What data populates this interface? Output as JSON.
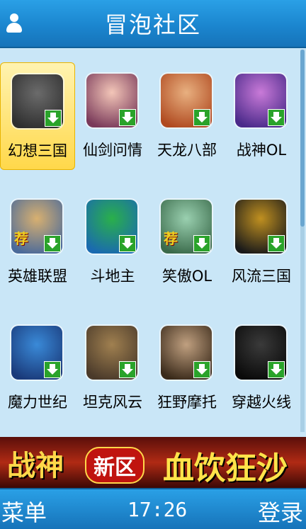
{
  "header": {
    "title": "冒泡社区",
    "user_icon": "user-icon"
  },
  "games": [
    {
      "label": "幻想三国",
      "selected": true,
      "recommended": false,
      "c1": "#6b6b6b",
      "c2": "#2f2f2f"
    },
    {
      "label": "仙剑问情",
      "selected": false,
      "recommended": false,
      "c1": "#f3c6b8",
      "c2": "#7a3a5a"
    },
    {
      "label": "天龙八部",
      "selected": false,
      "recommended": false,
      "c1": "#e8b080",
      "c2": "#b04a20"
    },
    {
      "label": "战神OL",
      "selected": false,
      "recommended": false,
      "c1": "#c97ad8",
      "c2": "#4a2a8a"
    },
    {
      "label": "英雄联盟",
      "selected": false,
      "recommended": true,
      "c1": "#d8b070",
      "c2": "#4a6a9a"
    },
    {
      "label": "斗地主",
      "selected": false,
      "recommended": false,
      "c1": "#2ab04a",
      "c2": "#1a6ab0"
    },
    {
      "label": "笑傲OL",
      "selected": false,
      "recommended": true,
      "c1": "#9ad0b0",
      "c2": "#3a6a4a"
    },
    {
      "label": "风流三国",
      "selected": false,
      "recommended": false,
      "c1": "#c09020",
      "c2": "#1a1a1a"
    },
    {
      "label": "魔力世纪",
      "selected": false,
      "recommended": false,
      "c1": "#3a8ad8",
      "c2": "#1a3a7a"
    },
    {
      "label": "坦克风云",
      "selected": false,
      "recommended": false,
      "c1": "#a08050",
      "c2": "#4a3a2a"
    },
    {
      "label": "狂野摩托",
      "selected": false,
      "recommended": false,
      "c1": "#c0a080",
      "c2": "#3a2a1a"
    },
    {
      "label": "穿越火线",
      "selected": false,
      "recommended": false,
      "c1": "#3a3a3a",
      "c2": "#0a0a0a"
    }
  ],
  "recommend_badge": "荐",
  "banner": {
    "part1": "战神",
    "part2": "新区",
    "part3": "血饮狂沙"
  },
  "softkeys": {
    "left": "菜单",
    "clock": "17:26",
    "right": "登录"
  }
}
